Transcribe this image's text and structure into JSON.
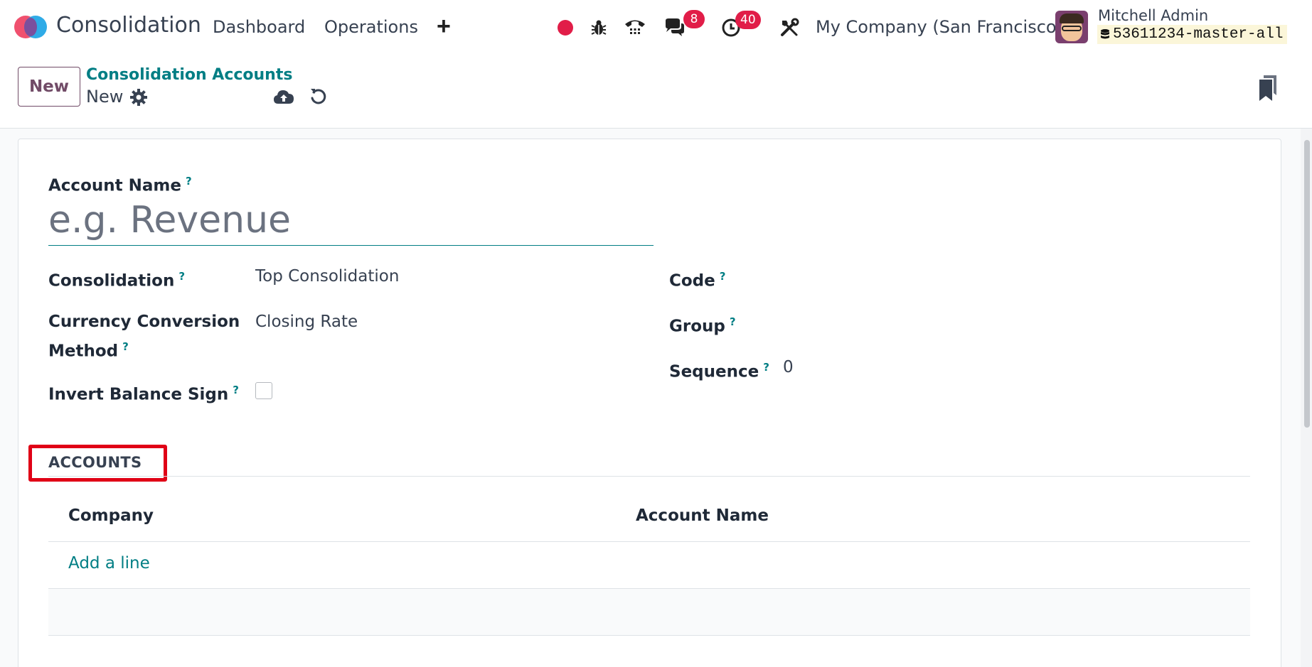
{
  "navbar": {
    "app_name": "Consolidation",
    "menu": [
      "Dashboard",
      "Operations"
    ],
    "add_icon": "plus-icon",
    "messages_count": "8",
    "activities_count": "40",
    "company": "My Company (San Francisco)",
    "user_name": "Mitchell Admin",
    "db_name": "53611234-master-all"
  },
  "control_panel": {
    "new_button": "New",
    "breadcrumb": "Consolidation Accounts",
    "record_title": "New"
  },
  "form": {
    "account_name_label": "Account Name",
    "account_name_placeholder": "e.g. Revenue",
    "consolidation_label": "Consolidation",
    "consolidation_value": "Top Consolidation",
    "currency_label_line1": "Currency Conversion",
    "currency_label_line2": "Method",
    "currency_value": "Closing Rate",
    "invert_label": "Invert Balance Sign",
    "invert_checked": false,
    "code_label": "Code",
    "group_label": "Group",
    "sequence_label": "Sequence",
    "sequence_value": "0",
    "help_mark": "?"
  },
  "accounts_tab": {
    "title": "ACCOUNTS",
    "columns": [
      "Company",
      "Account Name"
    ],
    "add_line": "Add a line"
  },
  "colors": {
    "brand": "#714b67",
    "link": "#017e84",
    "badge": "#e11d48",
    "highlight": "#e00016"
  }
}
